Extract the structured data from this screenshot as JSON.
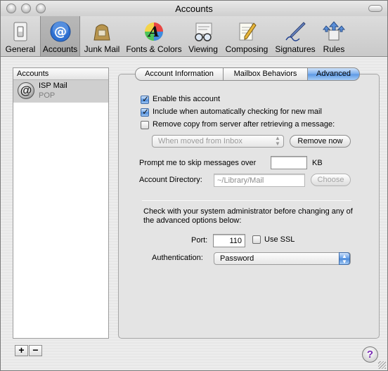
{
  "window": {
    "title": "Accounts"
  },
  "toolbar": {
    "items": [
      {
        "label": "General",
        "icon": "light-switch-icon"
      },
      {
        "label": "Accounts",
        "icon": "at-sign-icon",
        "selected": true
      },
      {
        "label": "Junk Mail",
        "icon": "junk-bag-icon"
      },
      {
        "label": "Fonts & Colors",
        "icon": "color-font-icon"
      },
      {
        "label": "Viewing",
        "icon": "glasses-icon"
      },
      {
        "label": "Composing",
        "icon": "pencil-paper-icon"
      },
      {
        "label": "Signatures",
        "icon": "pen-signature-icon"
      },
      {
        "label": "Rules",
        "icon": "rules-arrows-icon"
      }
    ]
  },
  "accounts": {
    "header": "Accounts",
    "list": [
      {
        "name": "ISP Mail",
        "type": "POP"
      }
    ],
    "add_label": "+",
    "remove_label": "−"
  },
  "tabs": [
    {
      "label": "Account Information",
      "active": false
    },
    {
      "label": "Mailbox Behaviors",
      "active": false
    },
    {
      "label": "Advanced",
      "active": true
    }
  ],
  "advanced": {
    "enable_account": {
      "label": "Enable this account",
      "checked": true
    },
    "include_checking": {
      "label": "Include when automatically checking for new mail",
      "checked": true
    },
    "remove_copy": {
      "label": "Remove copy from server after retrieving a message:",
      "checked": false
    },
    "remove_when": {
      "value": "When moved from Inbox"
    },
    "remove_now_label": "Remove now",
    "skip_prompt": {
      "label": "Prompt me to skip messages over",
      "value": "",
      "unit": "KB"
    },
    "account_dir": {
      "label": "Account Directory:",
      "value": "~/Library/Mail",
      "choose_label": "Choose"
    },
    "admin_note": "Check with your system administrator before changing any of the advanced options below:",
    "port": {
      "label": "Port:",
      "value": "110"
    },
    "ssl": {
      "label": "Use SSL",
      "checked": false
    },
    "auth": {
      "label": "Authentication:",
      "value": "Password"
    }
  },
  "help_label": "?",
  "colors": {
    "accent": "#5b98e4",
    "selected_row": "#cfcfcf"
  }
}
